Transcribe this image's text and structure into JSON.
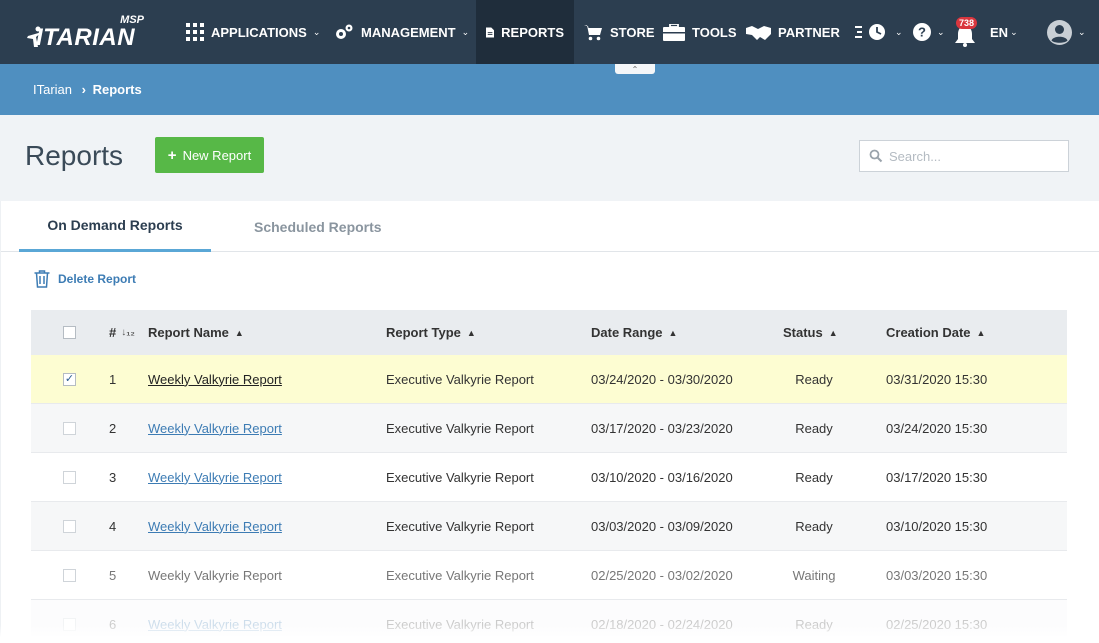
{
  "topnav": {
    "logo_msp": "MSP",
    "logo_brand": "ITARIAN",
    "items": [
      {
        "label": "APPLICATIONS",
        "icon": "grid-icon"
      },
      {
        "label": "MANAGEMENT",
        "icon": "gears-icon"
      },
      {
        "label": "REPORTS",
        "icon": "document-icon"
      },
      {
        "label": "STORE",
        "icon": "cart-icon"
      },
      {
        "label": "TOOLS",
        "icon": "toolbox-icon"
      },
      {
        "label": "PARTNER",
        "icon": "handshake-icon"
      }
    ],
    "notifications_count": "738",
    "language": "EN"
  },
  "breadcrumb": {
    "root": "ITarian",
    "current": "Reports"
  },
  "page": {
    "title": "Reports",
    "new_button": "New Report",
    "search_placeholder": "Search..."
  },
  "tabs": {
    "active": "On Demand Reports",
    "inactive": "Scheduled Reports"
  },
  "toolbar": {
    "delete_label": "Delete Report"
  },
  "table": {
    "headers": {
      "num": "#",
      "name": "Report Name",
      "type": "Report Type",
      "range": "Date Range",
      "status": "Status",
      "created": "Creation Date"
    },
    "rows": [
      {
        "num": "1",
        "name": "Weekly Valkyrie Report",
        "type": "Executive Valkyrie Report",
        "range": "03/24/2020 - 03/30/2020",
        "status": "Ready",
        "created": "03/31/2020 15:30",
        "checked": true
      },
      {
        "num": "2",
        "name": "Weekly Valkyrie Report",
        "type": "Executive Valkyrie Report",
        "range": "03/17/2020 - 03/23/2020",
        "status": "Ready",
        "created": "03/24/2020 15:30",
        "checked": false
      },
      {
        "num": "3",
        "name": "Weekly Valkyrie Report",
        "type": "Executive Valkyrie Report",
        "range": "03/10/2020 - 03/16/2020",
        "status": "Ready",
        "created": "03/17/2020 15:30",
        "checked": false
      },
      {
        "num": "4",
        "name": "Weekly Valkyrie Report",
        "type": "Executive Valkyrie Report",
        "range": "03/03/2020 - 03/09/2020",
        "status": "Ready",
        "created": "03/10/2020 15:30",
        "checked": false
      },
      {
        "num": "5",
        "name": "Weekly Valkyrie Report",
        "type": "Executive Valkyrie Report",
        "range": "02/25/2020 - 03/02/2020",
        "status": "Waiting",
        "created": "03/03/2020 15:30",
        "checked": false
      },
      {
        "num": "6",
        "name": "Weekly Valkyrie Report",
        "type": "Executive Valkyrie Report",
        "range": "02/18/2020 - 02/24/2020",
        "status": "Ready",
        "created": "02/25/2020 15:30",
        "checked": false
      }
    ]
  },
  "colors": {
    "nav_bg": "#2c3e50",
    "crumb_bg": "#4f8fc0",
    "accent_green": "#57b847",
    "link_blue": "#3d7cb4",
    "selected_row": "#fdfdd2"
  }
}
